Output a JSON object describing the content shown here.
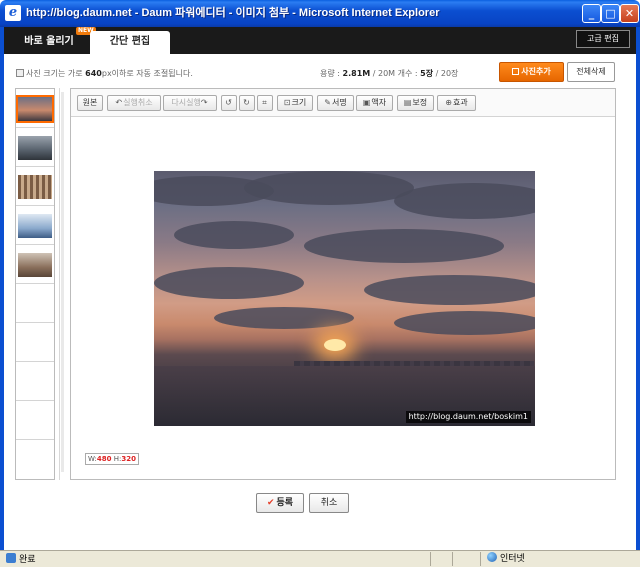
{
  "window": {
    "title": "http://blog.daum.net - Daum 파워에디터 - 이미지 첨부 - Microsoft Internet Explorer",
    "icon": "ie-icon"
  },
  "tabs": [
    {
      "label": "바로 올리기",
      "active": false
    },
    {
      "label": "간단 편집",
      "active": true
    }
  ],
  "badge": "NEW",
  "advanced_edit_label": "고급 편집",
  "info": {
    "note_pre": "사진 크기는 가로 ",
    "note_px": "640",
    "note_post": "px이하로 자동 조절됩니다.",
    "usage_label": "용량 : ",
    "usage_used": "2.81M",
    "usage_total": " / 20M",
    "count_label": "  개수 : ",
    "count_used": "5장",
    "count_total": " / 20장"
  },
  "buttons": {
    "add_photo": "사진추가",
    "delete_all": "전체삭제",
    "register": "등록",
    "cancel": "취소"
  },
  "toolbar": [
    {
      "key": "original",
      "label": "원본",
      "icon": ""
    },
    {
      "key": "undo",
      "label": "실행취소",
      "icon": "↶",
      "disabled": true
    },
    {
      "key": "redo",
      "label": "다시실행",
      "icon": "↷",
      "disabled": true
    },
    {
      "key": "rotate-left",
      "label": "",
      "icon": "↺"
    },
    {
      "key": "rotate-right",
      "label": "",
      "icon": "↻"
    },
    {
      "key": "crop",
      "label": "",
      "icon": "⌗"
    },
    {
      "key": "resize",
      "label": "크기",
      "icon": "⊡"
    },
    {
      "key": "signature",
      "label": "서명",
      "icon": "✎"
    },
    {
      "key": "frame",
      "label": "액자",
      "icon": "▣"
    },
    {
      "key": "adjust",
      "label": "보정",
      "icon": "▤"
    },
    {
      "key": "effect",
      "label": "효과",
      "icon": "⊕"
    }
  ],
  "photo": {
    "watermark": "http://blog.daum.net/boskim1",
    "size_w_label": "W:",
    "size_w": "480",
    "size_h_label": " H:",
    "size_h": "320"
  },
  "thumbnails": [
    {
      "theme": "sunset",
      "selected": true
    },
    {
      "theme": "clouds",
      "selected": false
    },
    {
      "theme": "forest",
      "selected": false
    },
    {
      "theme": "winter-tree",
      "selected": false
    },
    {
      "theme": "autumn",
      "selected": false
    }
  ],
  "status": {
    "done": "완료",
    "zone": "인터넷"
  },
  "colors": {
    "accent": "#e66600",
    "titlebar": "#0b4fd1"
  }
}
